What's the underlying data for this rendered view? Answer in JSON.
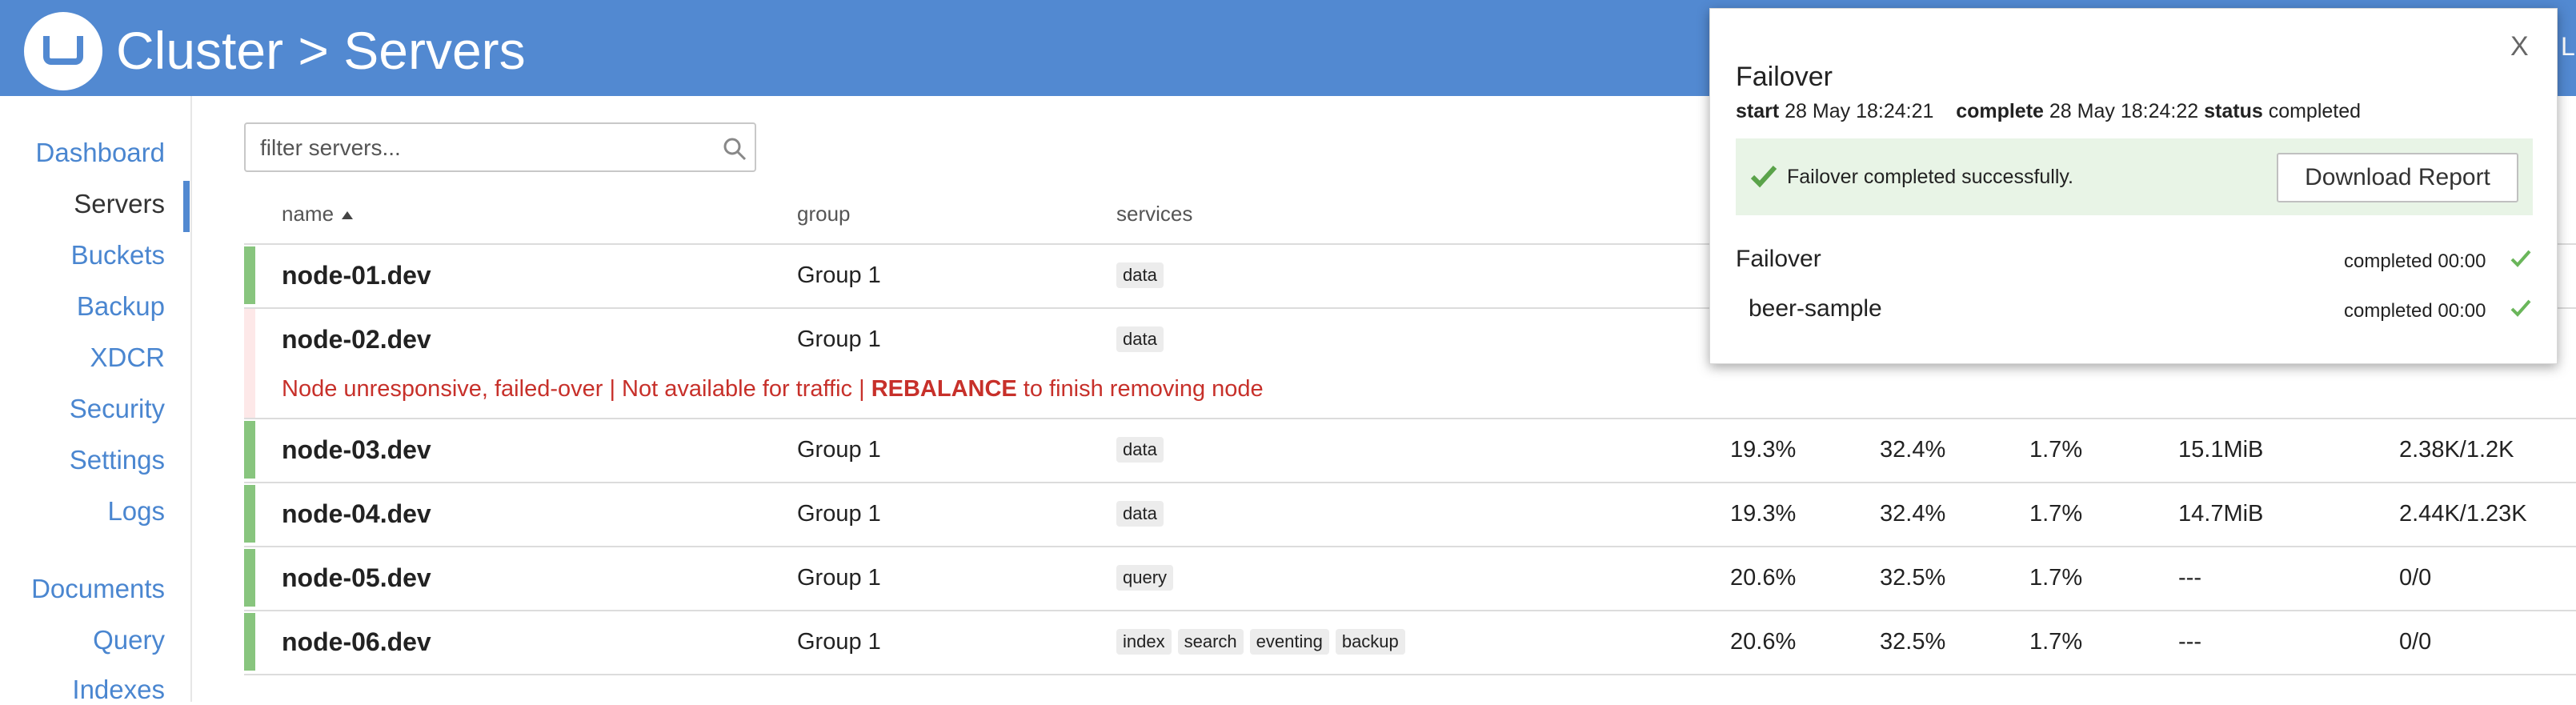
{
  "header": {
    "title": "Cluster > Servers",
    "right_text": "L"
  },
  "sidebar": {
    "items": [
      {
        "label": "Dashboard"
      },
      {
        "label": "Servers"
      },
      {
        "label": "Buckets"
      },
      {
        "label": "Backup"
      },
      {
        "label": "XDCR"
      },
      {
        "label": "Security"
      },
      {
        "label": "Settings"
      },
      {
        "label": "Logs"
      },
      {
        "label": "Documents"
      },
      {
        "label": "Query"
      },
      {
        "label": "Indexes"
      }
    ],
    "active": "Servers"
  },
  "filter": {
    "placeholder": "filter servers...",
    "value": ""
  },
  "table": {
    "columns": [
      "name",
      "group",
      "services"
    ],
    "rows": [
      {
        "name": "node-01.dev",
        "group": "Group 1",
        "services": [
          "data"
        ],
        "status": "healthy",
        "stats": []
      },
      {
        "name": "node-02.dev",
        "group": "Group 1",
        "services": [
          "data"
        ],
        "status": "failed",
        "warning": {
          "text": "Node unresponsive, failed-over | Not available for traffic | ",
          "strong": "REBALANCE",
          "suffix": " to finish removing node"
        },
        "stats": []
      },
      {
        "name": "node-03.dev",
        "group": "Group 1",
        "services": [
          "data"
        ],
        "status": "healthy",
        "stats": [
          "19.3%",
          "32.4%",
          "1.7%",
          "15.1MiB",
          "2.38K/1.2K"
        ]
      },
      {
        "name": "node-04.dev",
        "group": "Group 1",
        "services": [
          "data"
        ],
        "status": "healthy",
        "stats": [
          "19.3%",
          "32.4%",
          "1.7%",
          "14.7MiB",
          "2.44K/1.23K"
        ]
      },
      {
        "name": "node-05.dev",
        "group": "Group 1",
        "services": [
          "query"
        ],
        "status": "healthy",
        "stats": [
          "20.6%",
          "32.5%",
          "1.7%",
          "---",
          "0/0"
        ]
      },
      {
        "name": "node-06.dev",
        "group": "Group 1",
        "services": [
          "index",
          "search",
          "eventing",
          "backup"
        ],
        "status": "healthy",
        "stats": [
          "20.6%",
          "32.5%",
          "1.7%",
          "---",
          "0/0"
        ]
      }
    ]
  },
  "popup": {
    "close_label": "X",
    "title": "Failover",
    "start_label": "start",
    "start_value": "28 May 18:24:21",
    "complete_label": "complete",
    "complete_value": "28 May 18:24:22",
    "status_label": "status",
    "status_value": "completed",
    "success_message": "Failover completed successfully.",
    "download_label": "Download Report",
    "tasks": [
      {
        "title": "Failover",
        "status": "completed 00:00"
      },
      {
        "title": "beer-sample",
        "status": "completed 00:00"
      }
    ]
  },
  "colors": {
    "header": "#5289d1",
    "link": "#4a86d0",
    "healthy": "#88c57e",
    "failed": "#fde8e8",
    "warning_text": "#c7302a",
    "success_bg": "#e8f4e6",
    "check": "#5aa34a"
  }
}
